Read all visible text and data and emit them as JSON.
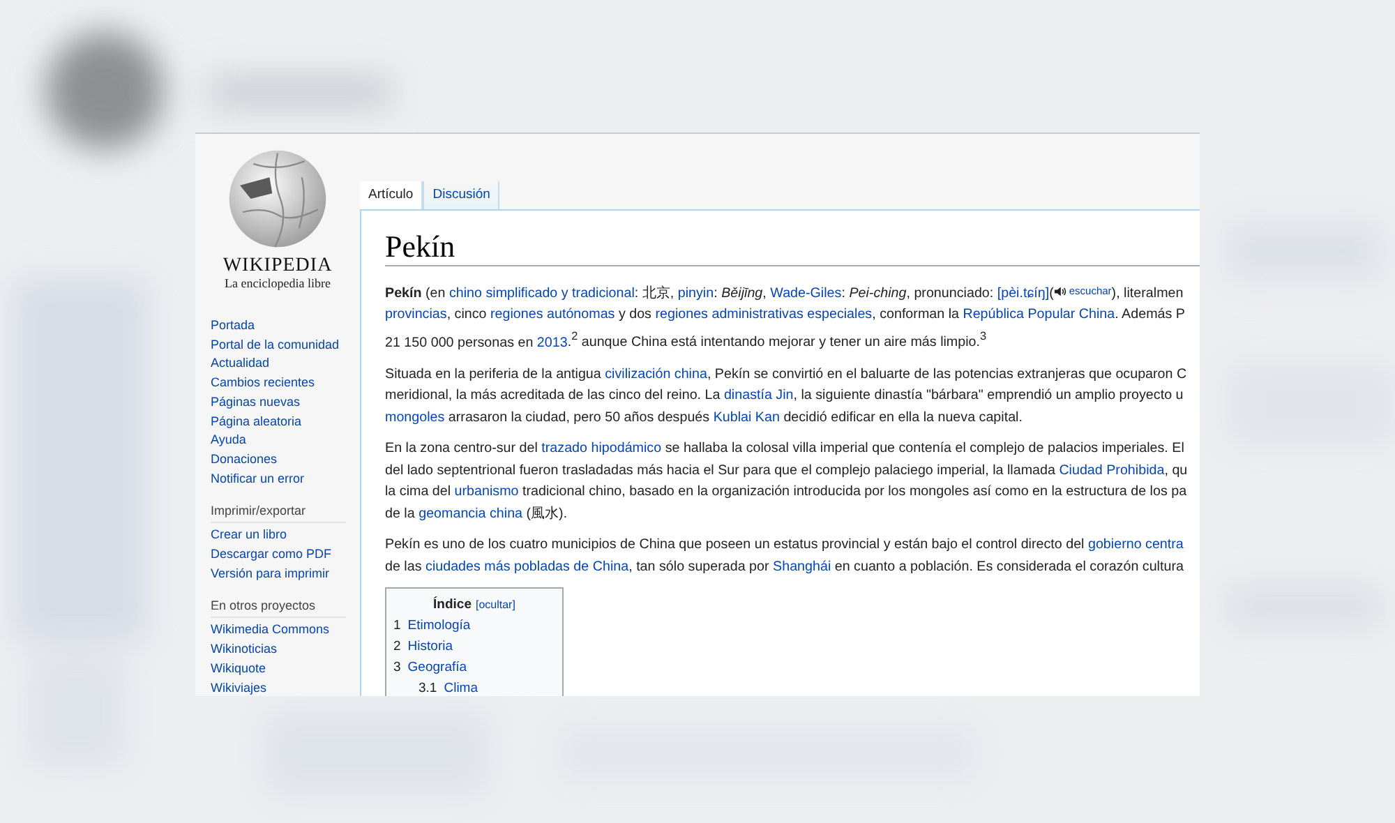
{
  "sidebar": {
    "wordmark": "WIKIPEDIA",
    "tagline": "La enciclopedia libre",
    "nav": [
      {
        "label": "Portada"
      },
      {
        "label": "Portal de la comunidad"
      },
      {
        "label": "Actualidad"
      },
      {
        "label": "Cambios recientes"
      },
      {
        "label": "Páginas nuevas"
      },
      {
        "label": "Página aleatoria"
      },
      {
        "label": "Ayuda"
      },
      {
        "label": "Donaciones"
      },
      {
        "label": "Notificar un error"
      }
    ],
    "sections": [
      {
        "heading": "Imprimir/exportar",
        "items": [
          {
            "label": "Crear un libro"
          },
          {
            "label": "Descargar como PDF"
          },
          {
            "label": "Versión para imprimir"
          }
        ]
      },
      {
        "heading": "En otros proyectos",
        "items": [
          {
            "label": "Wikimedia Commons"
          },
          {
            "label": "Wikinoticias"
          },
          {
            "label": "Wikiquote"
          },
          {
            "label": "Wikiviajes"
          }
        ]
      }
    ]
  },
  "tabs": [
    {
      "label": "Artículo",
      "selected": true
    },
    {
      "label": "Discusión",
      "selected": false
    }
  ],
  "article": {
    "title": "Pekín",
    "paragraphs": [
      {
        "lines": [
          [
            {
              "kind": "text",
              "text": "**Pekín** (en "
            },
            {
              "kind": "link",
              "text": "chino simplificado y tradicional"
            },
            {
              "kind": "text",
              "text": ": 北京, "
            },
            {
              "kind": "link",
              "text": "pinyin"
            },
            {
              "kind": "text",
              "text": ": *Běijīng*, "
            },
            {
              "kind": "link",
              "text": "Wade-Giles"
            },
            {
              "kind": "text",
              "text": ": *Pei-ching*, pronunciado: "
            },
            {
              "kind": "link",
              "text": "[pèi.tɕíŋ]"
            },
            {
              "kind": "text",
              "text": "("
            },
            {
              "kind": "audio",
              "text": "escuchar"
            },
            {
              "kind": "text",
              "text": "), literalmen"
            }
          ],
          [
            {
              "kind": "link",
              "text": "provincias"
            },
            {
              "kind": "text",
              "text": ", cinco "
            },
            {
              "kind": "link",
              "text": "regiones autónomas"
            },
            {
              "kind": "text",
              "text": " y dos "
            },
            {
              "kind": "link",
              "text": "regiones administrativas especiales"
            },
            {
              "kind": "text",
              "text": ", conforman la "
            },
            {
              "kind": "link",
              "text": "República Popular China"
            },
            {
              "kind": "text",
              "text": ". Además P"
            }
          ],
          [
            {
              "kind": "text",
              "text": "21 150 000 personas en "
            },
            {
              "kind": "link",
              "text": "2013"
            },
            {
              "kind": "text",
              "text": ".$^{2}$  aunque China está intentando mejorar y tener un aire más limpio.$^{3}$"
            }
          ]
        ]
      },
      {
        "lines": [
          [
            {
              "kind": "text",
              "text": "Situada en la periferia de la antigua "
            },
            {
              "kind": "link",
              "text": "civilización china"
            },
            {
              "kind": "text",
              "text": ", Pekín se convirtió en el baluarte de las potencias extranjeras que ocuparon C"
            }
          ],
          [
            {
              "kind": "text",
              "text": "meridional, la más acreditada de las cinco del reino. La "
            },
            {
              "kind": "link",
              "text": "dinastía Jin"
            },
            {
              "kind": "text",
              "text": ", la siguiente dinastía \"bárbara\" emprendió un amplio proyecto u"
            }
          ],
          [
            {
              "kind": "link",
              "text": "mongoles"
            },
            {
              "kind": "text",
              "text": " arrasaron la ciudad, pero 50 años después "
            },
            {
              "kind": "link",
              "text": "Kublai Kan"
            },
            {
              "kind": "text",
              "text": " decidió edificar en ella la nueva capital."
            }
          ]
        ]
      },
      {
        "lines": [
          [
            {
              "kind": "text",
              "text": "En la zona centro-sur del "
            },
            {
              "kind": "link",
              "text": "trazado hipodámico"
            },
            {
              "kind": "text",
              "text": " se hallaba la colosal villa imperial que contenía el complejo de palacios imperiales. El"
            }
          ],
          [
            {
              "kind": "text",
              "text": "del lado septentrional fueron trasladadas más hacia el Sur para que el complejo palaciego imperial, la llamada "
            },
            {
              "kind": "link",
              "text": "Ciudad Prohibida"
            },
            {
              "kind": "text",
              "text": ", qu"
            }
          ],
          [
            {
              "kind": "text",
              "text": "la cima del "
            },
            {
              "kind": "link",
              "text": "urbanismo"
            },
            {
              "kind": "text",
              "text": " tradicional chino, basado en la organización introducida por los mongoles así como en la estructura de los pa"
            }
          ],
          [
            {
              "kind": "text",
              "text": "de la "
            },
            {
              "kind": "link",
              "text": "geomancia china"
            },
            {
              "kind": "text",
              "text": " (風水)."
            }
          ]
        ]
      },
      {
        "lines": [
          [
            {
              "kind": "text",
              "text": "Pekín es uno de los cuatro municipios de China que poseen un estatus provincial y están bajo el control directo del "
            },
            {
              "kind": "link",
              "text": "gobierno centra"
            }
          ],
          [
            {
              "kind": "text",
              "text": "de las "
            },
            {
              "kind": "link",
              "text": "ciudades más pobladas de China"
            },
            {
              "kind": "text",
              "text": ", tan sólo superada por "
            },
            {
              "kind": "link",
              "text": "Shanghái"
            },
            {
              "kind": "text",
              "text": " en cuanto a población. Es considerada el corazón cultura"
            }
          ]
        ]
      }
    ],
    "toc": {
      "title": "Índice",
      "toggle": "[ocultar]",
      "items": [
        {
          "number": "1",
          "label": "Etimología"
        },
        {
          "number": "2",
          "label": "Historia"
        },
        {
          "number": "3",
          "label": "Geografía",
          "children": [
            {
              "number": "3.1",
              "label": "Clima"
            }
          ]
        }
      ]
    }
  }
}
